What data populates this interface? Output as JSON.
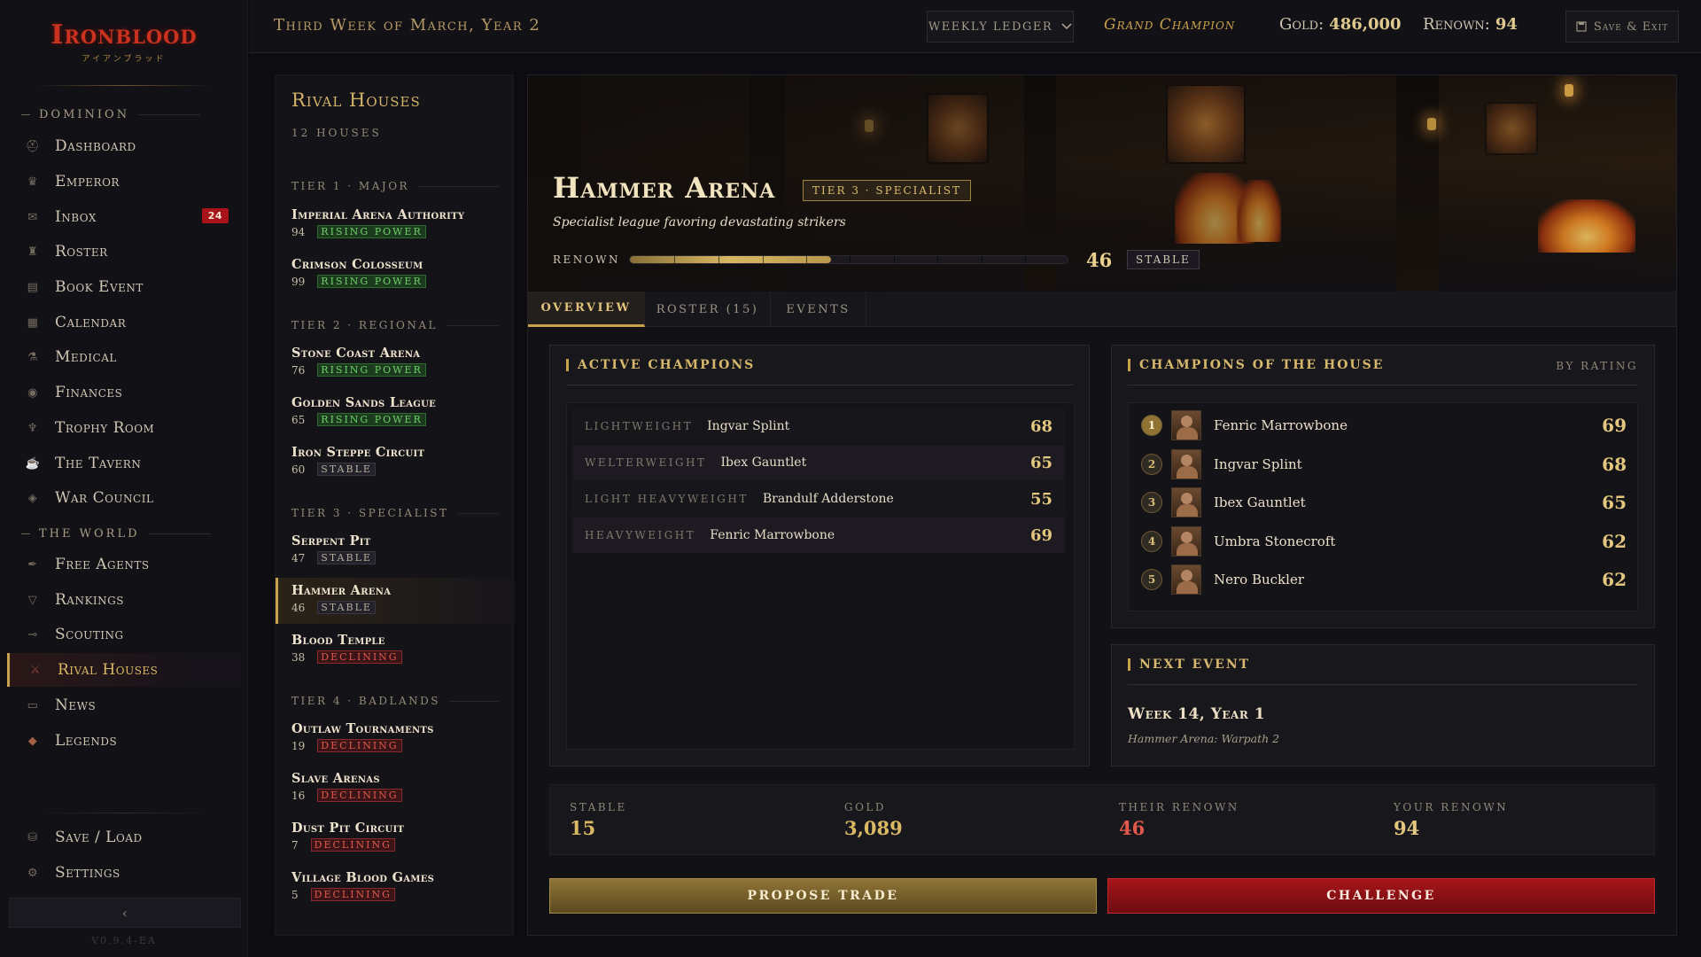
{
  "brand": {
    "logo_text": "Ironblood",
    "logo_subtitle": "アイアンブラッド",
    "version": "V0.9.4-EA"
  },
  "sidebar": {
    "sections": [
      {
        "label": "DOMINION"
      },
      {
        "label": "THE WORLD"
      }
    ],
    "dominion": [
      {
        "label": "Dashboard",
        "icon": "helmet-icon"
      },
      {
        "label": "Emperor",
        "icon": "crown-icon"
      },
      {
        "label": "Inbox",
        "icon": "scroll-icon",
        "badge": "24"
      },
      {
        "label": "Roster",
        "icon": "figure-icon"
      },
      {
        "label": "Book Event",
        "icon": "book-icon"
      },
      {
        "label": "Calendar",
        "icon": "calendar-icon"
      },
      {
        "label": "Medical",
        "icon": "potion-icon"
      },
      {
        "label": "Finances",
        "icon": "coins-icon"
      },
      {
        "label": "Trophy Room",
        "icon": "trophy-icon"
      },
      {
        "label": "The Tavern",
        "icon": "mug-icon"
      },
      {
        "label": "War Council",
        "icon": "eye-icon"
      }
    ],
    "world": [
      {
        "label": "Free Agents",
        "icon": "quill-icon"
      },
      {
        "label": "Rankings",
        "icon": "goblet-icon"
      },
      {
        "label": "Scouting",
        "icon": "spyglass-icon"
      },
      {
        "label": "Rival Houses",
        "icon": "swords-icon",
        "active": true
      },
      {
        "label": "News",
        "icon": "newspaper-icon"
      },
      {
        "label": "Legends",
        "icon": "flame-icon"
      }
    ],
    "footer": [
      {
        "label": "Save / Load",
        "icon": "save-icon"
      },
      {
        "label": "Settings",
        "icon": "gear-icon"
      }
    ],
    "collapse_label": "‹"
  },
  "topbar": {
    "date": "Third Week of March, Year 2",
    "ledger_label": "WEEKLY LEDGER",
    "champion_title": "Grand Champion",
    "gold_label": "Gold:",
    "gold_value": "486,000",
    "renown_label": "Renown:",
    "renown_value": "94",
    "save_label": "Save & Exit"
  },
  "rivals": {
    "title": "Rival Houses",
    "count": "12 HOUSES",
    "tiers": [
      {
        "label": "TIER 1 · MAJOR",
        "houses": [
          {
            "name": "Imperial Arena Authority",
            "renown": "94",
            "status": "RISING POWER",
            "kind": "rising"
          },
          {
            "name": "Crimson Colosseum",
            "renown": "99",
            "status": "RISING POWER",
            "kind": "rising"
          }
        ]
      },
      {
        "label": "TIER 2 · REGIONAL",
        "houses": [
          {
            "name": "Stone Coast Arena",
            "renown": "76",
            "status": "RISING POWER",
            "kind": "rising"
          },
          {
            "name": "Golden Sands League",
            "renown": "65",
            "status": "RISING POWER",
            "kind": "rising"
          },
          {
            "name": "Iron Steppe Circuit",
            "renown": "60",
            "status": "STABLE",
            "kind": "stable"
          }
        ]
      },
      {
        "label": "TIER 3 · SPECIALIST",
        "houses": [
          {
            "name": "Serpent Pit",
            "renown": "47",
            "status": "STABLE",
            "kind": "stable"
          },
          {
            "name": "Hammer Arena",
            "renown": "46",
            "status": "STABLE",
            "kind": "stable",
            "active": true
          },
          {
            "name": "Blood Temple",
            "renown": "38",
            "status": "DECLINING",
            "kind": "declining"
          }
        ]
      },
      {
        "label": "TIER 4 · BADLANDS",
        "houses": [
          {
            "name": "Outlaw Tournaments",
            "renown": "19",
            "status": "DECLINING",
            "kind": "declining"
          },
          {
            "name": "Slave Arenas",
            "renown": "16",
            "status": "DECLINING",
            "kind": "declining"
          },
          {
            "name": "Dust Pit Circuit",
            "renown": "7",
            "status": "DECLINING",
            "kind": "declining"
          },
          {
            "name": "Village Blood Games",
            "renown": "5",
            "status": "DECLINING",
            "kind": "declining"
          }
        ]
      }
    ]
  },
  "arena": {
    "name": "Hammer Arena",
    "tier_tag": "TIER 3 · SPECIALIST",
    "tagline": "Specialist league favoring devastating strikers",
    "renown_label": "RENOWN",
    "renown_value": "46",
    "renown_fraction": 0.46,
    "renown_state": "STABLE",
    "tabs": [
      {
        "label": "OVERVIEW",
        "active": true
      },
      {
        "label": "ROSTER (15)"
      },
      {
        "label": "EVENTS"
      }
    ],
    "active_champions": {
      "title": "ACTIVE CHAMPIONS",
      "rows": [
        {
          "weight": "LIGHTWEIGHT",
          "name": "Ingvar Splint",
          "rating": "68"
        },
        {
          "weight": "WELTERWEIGHT",
          "name": "Ibex Gauntlet",
          "rating": "65"
        },
        {
          "weight": "LIGHT HEAVYWEIGHT",
          "name": "Brandulf Adderstone",
          "rating": "55"
        },
        {
          "weight": "HEAVYWEIGHT",
          "name": "Fenric Marrowbone",
          "rating": "69"
        }
      ]
    },
    "house_champions": {
      "title": "CHAMPIONS OF THE HOUSE",
      "sort_label": "BY RATING",
      "rows": [
        {
          "rank": "1",
          "name": "Fenric Marrowbone",
          "rating": "69"
        },
        {
          "rank": "2",
          "name": "Ingvar Splint",
          "rating": "68"
        },
        {
          "rank": "3",
          "name": "Ibex Gauntlet",
          "rating": "65"
        },
        {
          "rank": "4",
          "name": "Umbra Stonecroft",
          "rating": "62"
        },
        {
          "rank": "5",
          "name": "Nero Buckler",
          "rating": "62"
        }
      ]
    },
    "next_event": {
      "title": "NEXT EVENT",
      "when": "Week 14, Year 1",
      "what": "Hammer Arena: Warpath 2"
    },
    "stats": [
      {
        "label": "STABLE",
        "value": "15",
        "color": "#d9b864"
      },
      {
        "label": "GOLD",
        "value": "3,089",
        "color": "#d9b864"
      },
      {
        "label": "THEIR RENOWN",
        "value": "46",
        "color": "#e0584c"
      },
      {
        "label": "YOUR RENOWN",
        "value": "94",
        "color": "#e4c77f"
      }
    ],
    "actions": {
      "trade_label": "PROPOSE TRADE",
      "challenge_label": "CHALLENGE"
    }
  },
  "colors": {
    "accent_gold": "#c8a24a",
    "danger_red": "#a61519",
    "rising_green": "#6fd06a"
  }
}
